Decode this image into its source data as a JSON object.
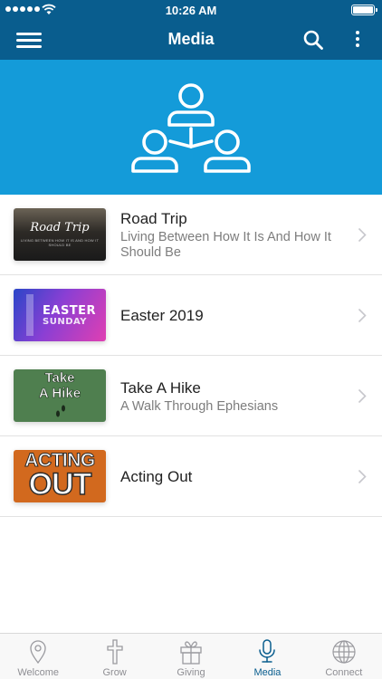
{
  "status_bar": {
    "time": "10:26 AM"
  },
  "nav": {
    "title": "Media"
  },
  "colors": {
    "nav": "#095d8e",
    "hero": "#149bd9",
    "active_tab": "#095d8e"
  },
  "items": [
    {
      "title": "Road Trip",
      "subtitle": "Living Between How It Is And How It Should Be",
      "thumb_line1": "Road Trip",
      "thumb_line2": "LIVING BETWEEN HOW IT IS AND HOW IT SHOULD BE"
    },
    {
      "title": "Easter 2019",
      "subtitle": "",
      "thumb_line1": "EASTER",
      "thumb_line2": "SUNDAY"
    },
    {
      "title": "Take A Hike",
      "subtitle": "A Walk Through Ephesians",
      "thumb_line1": "Take",
      "thumb_line2": "A Hike"
    },
    {
      "title": "Acting Out",
      "subtitle": "",
      "thumb_line1": "ACTING",
      "thumb_line2": "OUT"
    }
  ],
  "tabs": [
    {
      "label": "Welcome",
      "icon": "map-pin-icon"
    },
    {
      "label": "Grow",
      "icon": "cross-icon"
    },
    {
      "label": "Giving",
      "icon": "gift-icon"
    },
    {
      "label": "Media",
      "icon": "microphone-icon",
      "active": true
    },
    {
      "label": "Connect",
      "icon": "globe-icon"
    }
  ]
}
